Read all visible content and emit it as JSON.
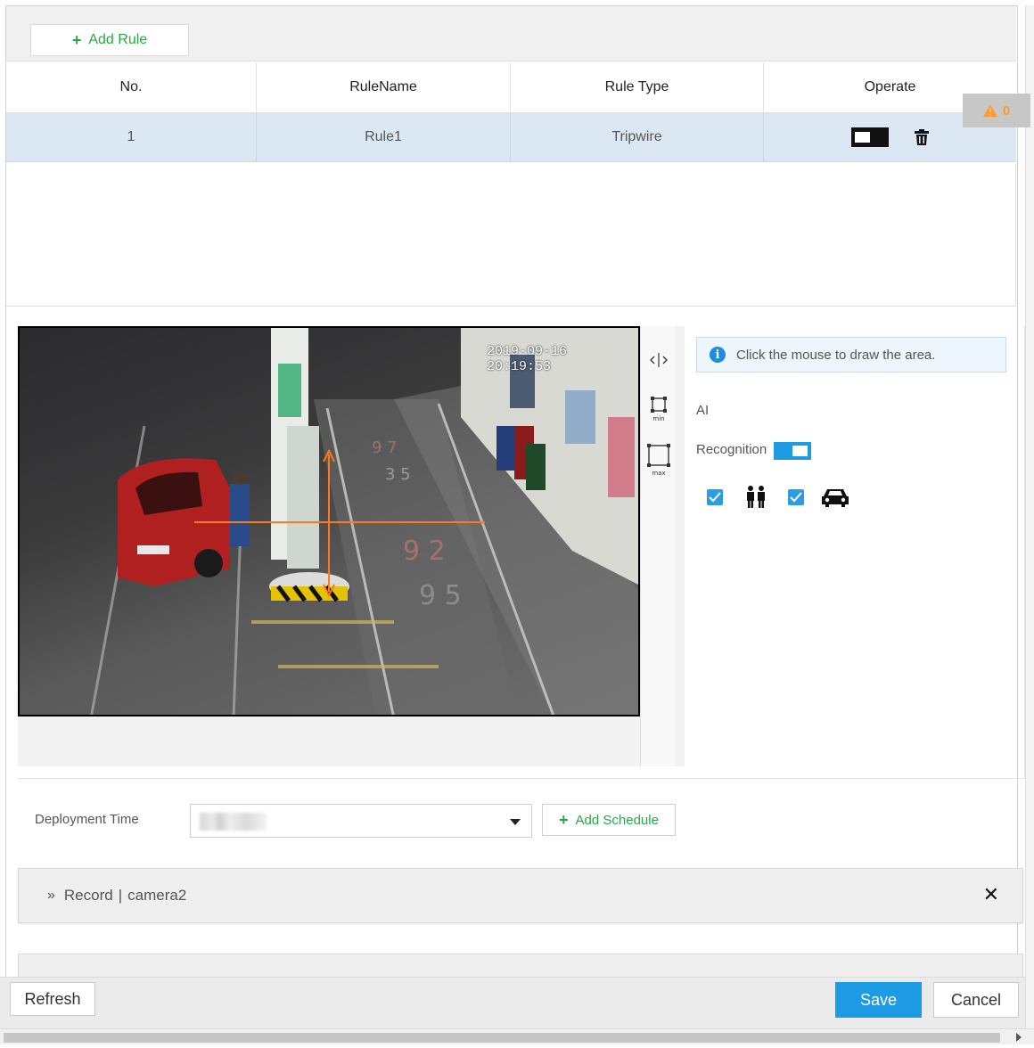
{
  "toolbar": {
    "add_rule_label": "Add Rule"
  },
  "table": {
    "headers": [
      "No.",
      "RuleName",
      "Rule Type",
      "Operate"
    ],
    "rows": [
      {
        "no": "1",
        "name": "Rule1",
        "type": "Tripwire",
        "enabled": false
      }
    ]
  },
  "warning_badge": {
    "count": "0"
  },
  "video": {
    "timestamp": "2019-09-16 20:19:53",
    "tools": [
      "move-icon",
      "min-size-icon",
      "max-size-icon"
    ],
    "tool_labels": {
      "min": "min",
      "max": "max"
    }
  },
  "panel": {
    "hint": "Click the mouse to draw the area.",
    "ai_label": "AI",
    "recognition_label": "Recognition",
    "recognition_enabled": true,
    "targets": [
      {
        "icon": "people-icon",
        "checked": true
      },
      {
        "icon": "car-icon",
        "checked": true
      }
    ]
  },
  "deployment": {
    "label": "Deployment Time",
    "add_schedule_label": "Add Schedule"
  },
  "record": {
    "prefix": "Record",
    "divider": "|",
    "camera": "camera2"
  },
  "footer": {
    "refresh": "Refresh",
    "save": "Save",
    "cancel": "Cancel"
  },
  "colors": {
    "accent_blue": "#1e9be5",
    "green": "#27a845",
    "row_selected": "#dbe8f4",
    "tripwire": "#ff7a1a"
  }
}
